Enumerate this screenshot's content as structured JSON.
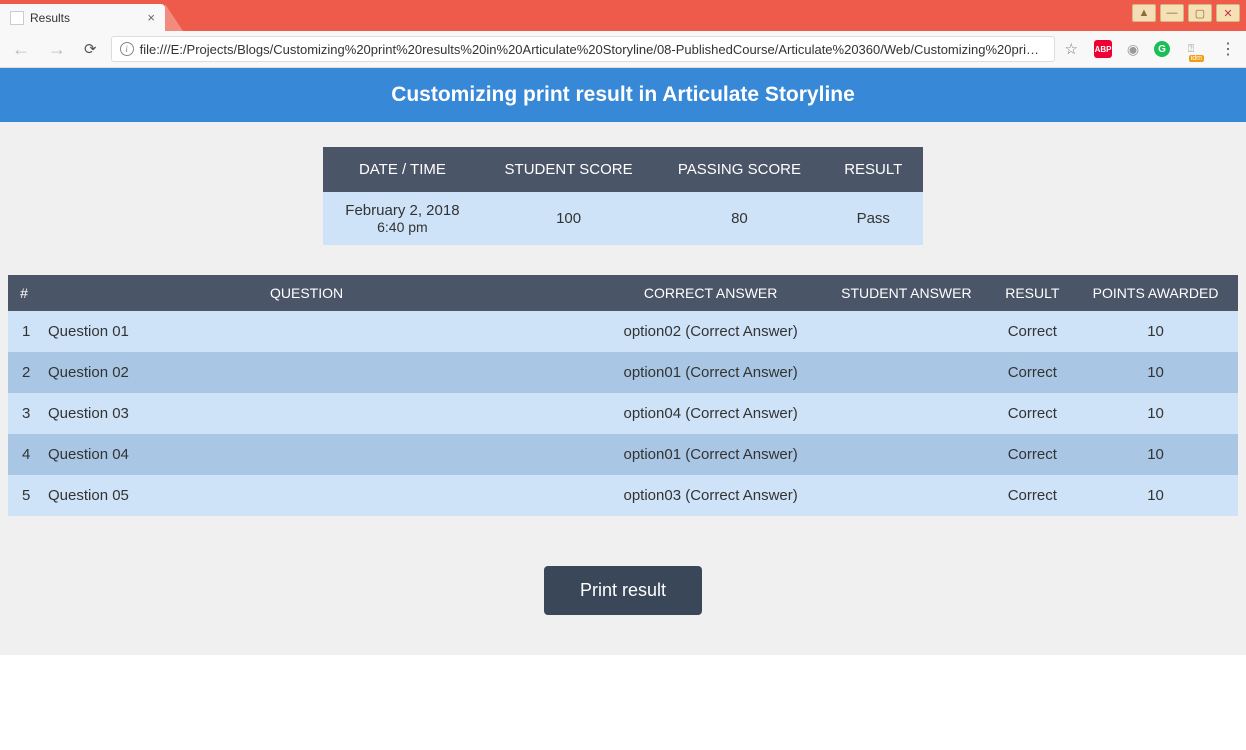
{
  "browser": {
    "tab_title": "Results",
    "url": "file:///E:/Projects/Blogs/Customizing%20print%20results%20in%20Articulate%20Storyline/08-PublishedCourse/Articulate%20360/Web/Customizing%20pri…"
  },
  "header": {
    "title": "Customizing print result in Articulate Storyline"
  },
  "summary": {
    "headers": {
      "datetime": "DATE / TIME",
      "student_score": "STUDENT SCORE",
      "passing_score": "PASSING SCORE",
      "result": "RESULT"
    },
    "row": {
      "date": "February 2, 2018",
      "time": "6:40 pm",
      "student_score": "100",
      "passing_score": "80",
      "result": "Pass"
    }
  },
  "results": {
    "headers": {
      "num": "#",
      "question": "QUESTION",
      "correct_answer": "CORRECT ANSWER",
      "student_answer": "STUDENT ANSWER",
      "result": "RESULT",
      "points": "POINTS AWARDED"
    },
    "rows": [
      {
        "num": "1",
        "question": "Question 01",
        "correct_answer": "option02 (Correct Answer)",
        "student_answer": "",
        "result": "Correct",
        "points": "10"
      },
      {
        "num": "2",
        "question": "Question 02",
        "correct_answer": "option01 (Correct Answer)",
        "student_answer": "",
        "result": "Correct",
        "points": "10"
      },
      {
        "num": "3",
        "question": "Question 03",
        "correct_answer": "option04 (Correct Answer)",
        "student_answer": "",
        "result": "Correct",
        "points": "10"
      },
      {
        "num": "4",
        "question": "Question 04",
        "correct_answer": "option01 (Correct Answer)",
        "student_answer": "",
        "result": "Correct",
        "points": "10"
      },
      {
        "num": "5",
        "question": "Question 05",
        "correct_answer": "option03 (Correct Answer)",
        "student_answer": "",
        "result": "Correct",
        "points": "10"
      }
    ]
  },
  "buttons": {
    "print": "Print result"
  }
}
